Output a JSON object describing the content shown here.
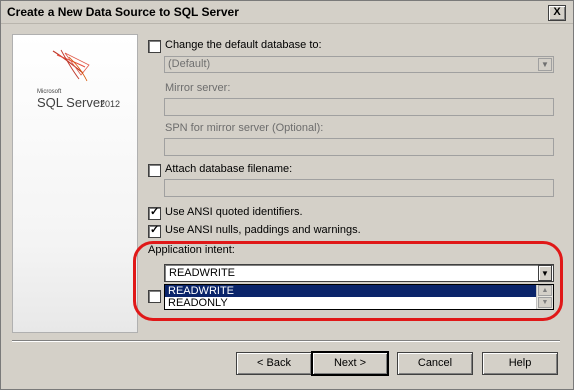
{
  "window": {
    "title": "Create a New Data Source to SQL Server",
    "close_label": "X"
  },
  "logo": {
    "company": "Microsoft",
    "product": "SQL Server",
    "version": "2012"
  },
  "form": {
    "change_default_db": {
      "label": "Change the default database to:",
      "checked": false
    },
    "default_db_value": "(Default)",
    "mirror_server_label": "Mirror server:",
    "spn_label": "SPN for mirror server (Optional):",
    "attach_db": {
      "label": "Attach database filename:",
      "checked": false
    },
    "ansi_quoted": {
      "label": "Use ANSI quoted identifiers.",
      "checked": true
    },
    "ansi_nulls": {
      "label": "Use ANSI nulls, paddings and warnings.",
      "checked": true
    },
    "app_intent_label": "Application intent:",
    "app_intent_value": "READWRITE",
    "app_intent_options": [
      "READWRITE",
      "READONLY"
    ]
  },
  "buttons": {
    "back": "< Back",
    "next": "Next >",
    "cancel": "Cancel",
    "help": "Help"
  },
  "colors": {
    "highlight": "#e01818",
    "selection": "#0a246a"
  }
}
